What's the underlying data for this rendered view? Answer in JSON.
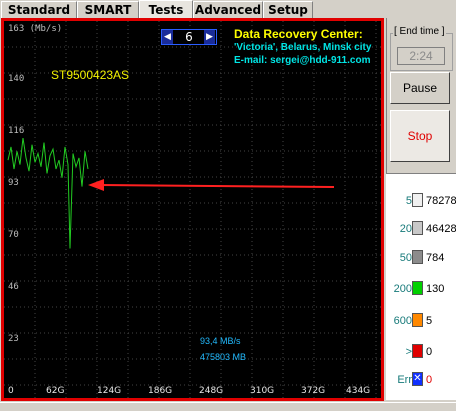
{
  "tabs": [
    {
      "label": "Standard",
      "active": false
    },
    {
      "label": "SMART",
      "active": false
    },
    {
      "label": "Tests",
      "active": true
    },
    {
      "label": "Advanced",
      "active": false
    },
    {
      "label": "Setup",
      "active": false
    }
  ],
  "graph": {
    "y_top_label": "163 (Mb/s)",
    "y_labels": [
      "140",
      "116",
      "93",
      "70",
      "46",
      "23"
    ],
    "x_labels": [
      "0",
      "62G",
      "124G",
      "186G",
      "248G",
      "310G",
      "372G",
      "434G"
    ],
    "model": "ST9500423AS",
    "spin_value": "6",
    "center_title": "Data Recovery Center:",
    "center_line1": "'Victoria', Belarus, Minsk city",
    "center_line2": "E-mail: sergei@hdd-911.com",
    "speed": "93,4 MB/s",
    "position": "475803 MB",
    "trace_color": "#22cc22"
  },
  "chart_data": {
    "type": "line",
    "xlabel": "",
    "ylabel": "(Mb/s)",
    "ylim": [
      0,
      163
    ],
    "x_ticks": [
      "0",
      "62G",
      "124G",
      "186G",
      "248G",
      "310G",
      "372G",
      "434G"
    ],
    "y_ticks": [
      23,
      46,
      70,
      93,
      116,
      140,
      163
    ],
    "series": [
      {
        "x": [
          0,
          3,
          6,
          9,
          12,
          15,
          18,
          21,
          24,
          27,
          30,
          33,
          36,
          39,
          42,
          45,
          48,
          51,
          54,
          57,
          60,
          62,
          65,
          68,
          71,
          74,
          77,
          80
        ],
        "y": [
          100,
          106,
          96,
          104,
          98,
          110,
          101,
          95,
          107,
          99,
          103,
          97,
          108,
          94,
          102,
          105,
          96,
          100,
          92,
          106,
          98,
          60,
          103,
          97,
          101,
          88,
          104,
          96
        ]
      }
    ]
  },
  "sidebar": {
    "end_time_label": "[ End time ]",
    "end_time_value": "2:24",
    "pause_label": "Pause",
    "stop_label": "Stop"
  },
  "stats": [
    {
      "label": "5",
      "color": "#f0f0f0",
      "count": "78278"
    },
    {
      "label": "20",
      "color": "#c8c8c8",
      "count": "46428"
    },
    {
      "label": "50",
      "color": "#8c8c8c",
      "count": "784"
    },
    {
      "label": "200",
      "color": "#00d000",
      "count": "130"
    },
    {
      "label": "600",
      "color": "#ff8800",
      "count": "5"
    },
    {
      "label": ">",
      "color": "#e00000",
      "count": "0"
    },
    {
      "label": "Err",
      "color": "#1030ff",
      "count": "0"
    }
  ]
}
